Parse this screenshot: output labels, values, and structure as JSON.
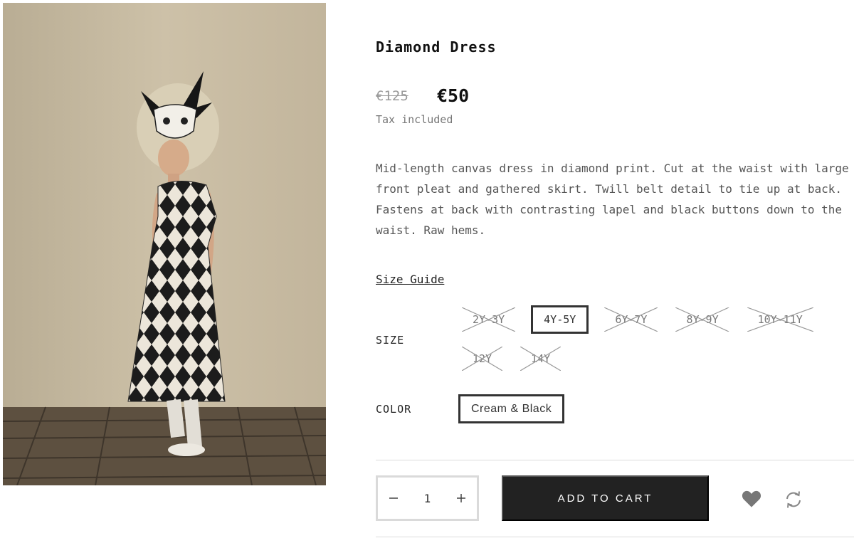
{
  "product": {
    "title": "Diamond Dress",
    "price_old": "€125",
    "price_new": "€50",
    "tax_note": "Tax included",
    "description": "Mid-length canvas dress in diamond print. Cut at the waist with large front pleat and gathered skirt. Twill belt detail to tie up at back. Fastens at back with contrasting lapel and black buttons down to the waist. Raw hems."
  },
  "size_guide_label": "Size Guide",
  "size": {
    "label": "SIZE",
    "options": [
      {
        "label": "2Y-3Y",
        "available": false,
        "selected": false
      },
      {
        "label": "4Y-5Y",
        "available": true,
        "selected": true
      },
      {
        "label": "6Y-7Y",
        "available": false,
        "selected": false
      },
      {
        "label": "8Y-9Y",
        "available": false,
        "selected": false
      },
      {
        "label": "10Y-11Y",
        "available": false,
        "selected": false
      },
      {
        "label": "12Y",
        "available": false,
        "selected": false
      },
      {
        "label": "14Y",
        "available": false,
        "selected": false
      }
    ]
  },
  "color": {
    "label": "COLOR",
    "selected": "Cream & Black"
  },
  "cart": {
    "quantity": "1",
    "add_to_cart_label": "ADD TO CART"
  },
  "icons": {
    "wishlist": "heart-icon",
    "compare": "compare-refresh-icon",
    "minus": "minus-icon",
    "plus": "plus-icon"
  },
  "colors": {
    "text": "#222222",
    "button_bg": "#222222",
    "muted": "#777777",
    "border": "#dadada"
  }
}
